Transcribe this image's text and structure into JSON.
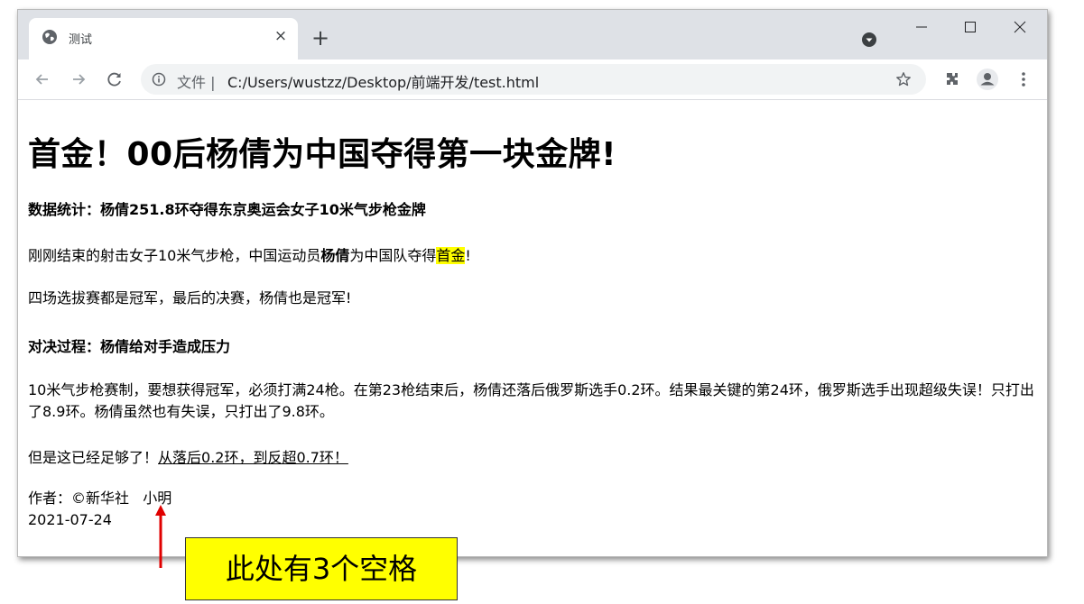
{
  "browser": {
    "tab_title": "测试",
    "tab_close": "×",
    "new_tab": "+",
    "address_chip": "文件",
    "address_separator": "|",
    "url": "C:/Users/wustzz/Desktop/前端开发/test.html",
    "icons": [
      "globe-icon",
      "close-icon",
      "plus-icon",
      "profile-dropdown-icon",
      "minimize-icon",
      "maximize-icon",
      "close-window-icon",
      "back-icon",
      "forward-icon",
      "reload-icon",
      "info-icon",
      "star-icon",
      "extensions-icon",
      "avatar-icon",
      "menu-icon"
    ]
  },
  "page": {
    "title": "首金！00后杨倩为中国夺得第一块金牌!",
    "subtitle1": "数据统计：杨倩251.8环夺得东京奥运会女子10米气步枪金牌",
    "p1_pre": "刚刚结束的射击女子10米气步枪，中国运动员",
    "p1_bold": "杨倩",
    "p1_mid": "为中国队夺得",
    "p1_mark": "首金",
    "p1_post": "!",
    "p2": "四场选拔赛都是冠军，最后的决赛，杨倩也是冠军!",
    "subtitle2": "对决过程：杨倩给对手造成压力",
    "p3": "10米气步枪赛制，要想获得冠军，必须打满24枪。在第23枪结束后，杨倩还落后俄罗斯选手0.2环。结果最关键的第24环，俄罗斯选手出现超级失误！只打出了8.9环。杨倩虽然也有失误，只打出了9.8环。",
    "p4_pre": "但是这已经足够了！",
    "p4_underline": "从落后0.2环，到反超0.7环！",
    "author_line": "作者：©新华社   小明",
    "date_line": "2021-07-24"
  },
  "annotation": {
    "callout_text": "此处有3个空格",
    "arrow_color": "#e00000",
    "callout_bg": "#ffff00"
  }
}
